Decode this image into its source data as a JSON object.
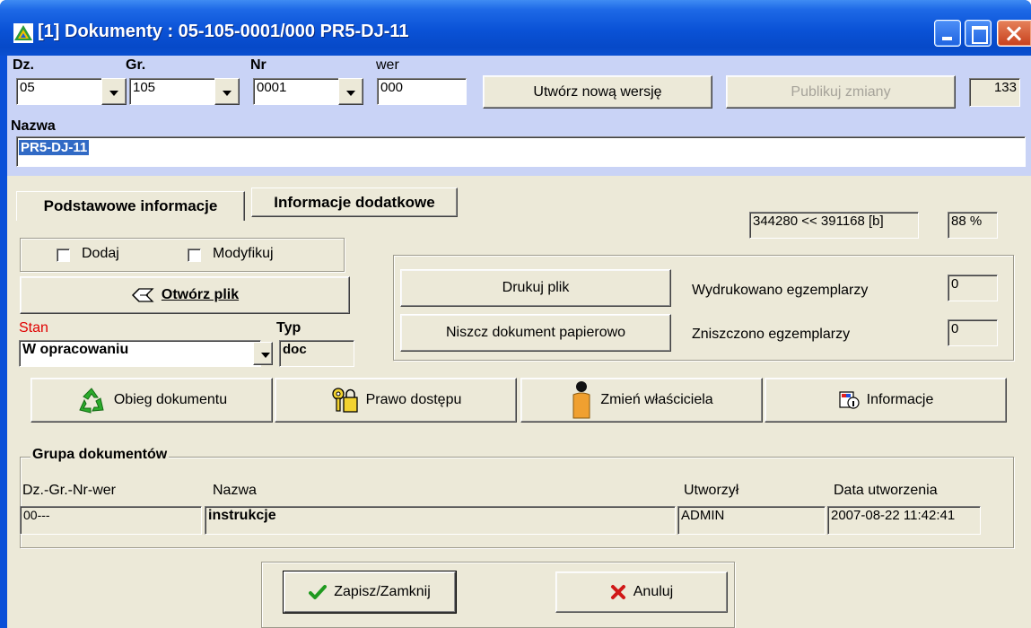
{
  "window": {
    "title": "[1] Dokumenty : 05-105-0001/000 PR5-DJ-11"
  },
  "header": {
    "dz_label": "Dz.",
    "gr_label": "Gr.",
    "nr_label": "Nr",
    "wer_label": "wer",
    "dz_value": "05",
    "gr_value": "105",
    "nr_value": "0001",
    "wer_value": "000",
    "new_version_button": "Utwórz nową wersję",
    "publish_button": "Publikuj zmiany",
    "counter_value": "133",
    "name_label": "Nazwa",
    "name_value": "PR5-DJ-11"
  },
  "tabs": [
    {
      "label": "Podstawowe informacje",
      "active": true
    },
    {
      "label": "Informacje dodatkowe",
      "active": false
    }
  ],
  "file_info": {
    "size_text": "344280 << 391168 [b]",
    "ratio_text": "88 %"
  },
  "checkboxes": {
    "add_label": "Dodaj",
    "modify_label": "Modyfikuj",
    "add_checked": false,
    "modify_checked": false
  },
  "open_file_button": "Otwórz plik",
  "state": {
    "label": "Stan",
    "value": "W opracowaniu",
    "type_label": "Typ",
    "type_value": "doc",
    "label_color": "#e00000"
  },
  "print_panel": {
    "print_button": "Drukuj plik",
    "destroy_button": "Niszcz dokument papierowo",
    "printed_label": "Wydrukowano egzemplarzy",
    "printed_value": "0",
    "destroyed_label": "Zniszczono egzemplarzy",
    "destroyed_value": "0"
  },
  "actions": {
    "workflow_button": "Obieg dokumentu",
    "access_button": "Prawo dostępu",
    "owner_button": "Zmień właściciela",
    "info_button": "Informacje"
  },
  "group": {
    "title": "Grupa dokumentów",
    "columns": [
      "Dz.-Gr.-Nr-wer",
      "Nazwa",
      "Utworzył",
      "Data utworzenia"
    ],
    "row": [
      "00---",
      "instrukcje",
      "ADMIN",
      "2007-08-22 11:42:41"
    ]
  },
  "footer": {
    "save_button": "Zapisz/Zamknij",
    "cancel_button": "Anuluj"
  }
}
